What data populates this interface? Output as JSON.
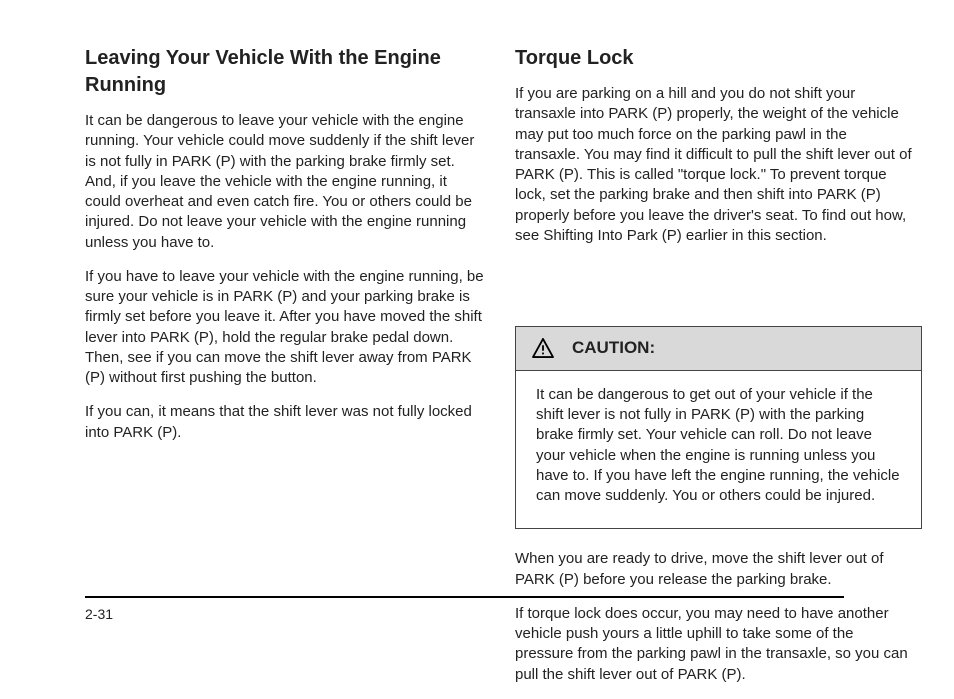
{
  "left": {
    "title": "Leaving Your Vehicle With the Engine Running",
    "para1": "It can be dangerous to leave your vehicle with the engine running. Your vehicle could move suddenly if the shift lever is not fully in PARK (P) with the parking brake firmly set. And, if you leave the vehicle with the engine running, it could overheat and even catch fire. You or others could be injured. Do not leave your vehicle with the engine running unless you have to.",
    "para2": "If you have to leave your vehicle with the engine running, be sure your vehicle is in PARK (P) and your parking brake is firmly set before you leave it. After you have moved the shift lever into PARK (P), hold the regular brake pedal down. Then, see if you can move the shift lever away from PARK (P) without first pushing the button.",
    "para3": "If you can, it means that the shift lever was not fully locked into PARK (P)."
  },
  "right": {
    "title": "Torque Lock",
    "para1": "If you are parking on a hill and you do not shift your transaxle into PARK (P) properly, the weight of the vehicle may put too much force on the parking pawl in the transaxle. You may find it difficult to pull the shift lever out of PARK (P). This is called \"torque lock.\" To prevent torque lock, set the parking brake and then shift into PARK (P) properly before you leave the driver's seat. To find out how, see Shifting Into Park (P) earlier in this section.",
    "para2": "When you are ready to drive, move the shift lever out of PARK (P) before you release the parking brake.",
    "para3": "If torque lock does occur, you may need to have another vehicle push yours a little uphill to take some of the pressure from the parking pawl in the transaxle, so you can pull the shift lever out of PARK (P).",
    "caution": {
      "label": "CAUTION:",
      "body": "It can be dangerous to get out of your vehicle if the shift lever is not fully in PARK (P) with the parking brake firmly set. Your vehicle can roll. Do not leave your vehicle when the engine is running unless you have to. If you have left the engine running, the vehicle can move suddenly. You or others could be injured."
    }
  },
  "page_number": "2-31"
}
